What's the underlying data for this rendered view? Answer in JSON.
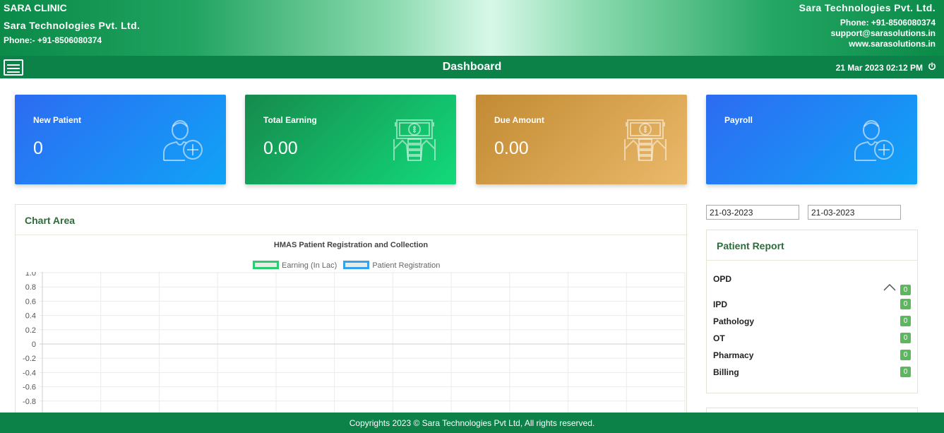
{
  "header": {
    "clinic_name": "SARA CLINIC",
    "company": "Sara Technologies Pvt. Ltd.",
    "phone_left": "Phone:- +91-8506080374",
    "company_right": "Sara Technologies Pvt. Ltd.",
    "phone_right": "Phone: +91-8506080374",
    "email": "support@sarasolutions.in",
    "website": "www.sarasolutions.in"
  },
  "navbar": {
    "title": "Dashboard",
    "datetime": "21 Mar 2023 02:12 PM",
    "menu_icon": "hamburger-menu-icon",
    "power_icon": "power-icon"
  },
  "cards": [
    {
      "title": "New Patient",
      "value": "0",
      "icon": "add-user-icon"
    },
    {
      "title": "Total Earning",
      "value": "0.00",
      "icon": "money-hand-icon"
    },
    {
      "title": "Due Amount",
      "value": "0.00",
      "icon": "money-hand-icon"
    },
    {
      "title": "Payroll",
      "value": "",
      "icon": "add-user-icon"
    }
  ],
  "chart_panel": {
    "heading": "Chart Area"
  },
  "chart_data": {
    "type": "line",
    "title": "HMAS Patient Registration and Collection",
    "series": [
      {
        "name": "Earning (In Lac)",
        "color": "#2ecc71",
        "values": []
      },
      {
        "name": "Patient Registration",
        "color": "#36a2eb",
        "values": []
      }
    ],
    "yticks": [
      "1.0",
      "0.8",
      "0.6",
      "0.4",
      "0.2",
      "0",
      "-0.2",
      "-0.4",
      "-0.6",
      "-0.8"
    ],
    "ylim": [
      -1.0,
      1.0
    ],
    "grid": true,
    "legend": "top"
  },
  "filters": {
    "from_date": "21-03-2023",
    "to_date": "21-03-2023"
  },
  "patient_report": {
    "heading": "Patient Report",
    "rows": [
      {
        "label": "OPD",
        "count": "0"
      },
      {
        "label": "IPD",
        "count": "0"
      },
      {
        "label": "Pathology",
        "count": "0"
      },
      {
        "label": "OT",
        "count": "0"
      },
      {
        "label": "Pharmacy",
        "count": "0"
      },
      {
        "label": "Billing",
        "count": "0"
      }
    ],
    "collapse_icon": "chevron-up-icon"
  },
  "footer": {
    "text": "Copyrights 2023 © Sara Technologies Pvt Ltd, All rights reserved."
  }
}
